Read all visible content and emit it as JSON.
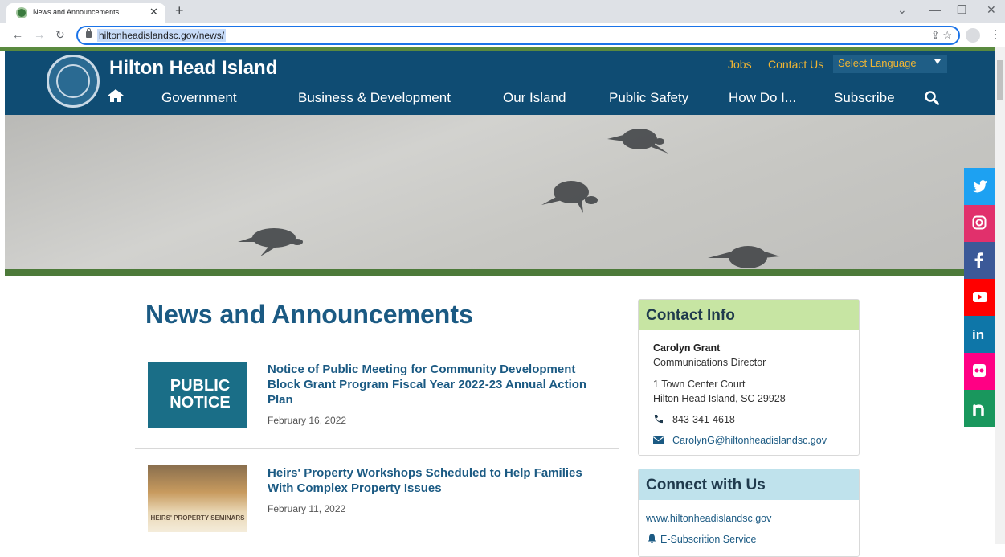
{
  "browser": {
    "tab_title": "News and Announcements",
    "url": "hiltonheadislandsc.gov/news/"
  },
  "site": {
    "title": "Hilton Head Island",
    "util_links": [
      "Jobs",
      "Contact Us"
    ],
    "language_select": "Select Language",
    "nav": [
      "Government",
      "Business & Development",
      "Our Island",
      "Public Safety",
      "How Do I...",
      "Subscribe"
    ]
  },
  "social": [
    {
      "icon": "twitter-icon",
      "color": "#1da1f2"
    },
    {
      "icon": "instagram-icon",
      "color": "#e1306c"
    },
    {
      "icon": "facebook-icon",
      "color": "#3b5998"
    },
    {
      "icon": "youtube-icon",
      "color": "#ff0000"
    },
    {
      "icon": "linkedin-icon",
      "color": "#0e76a8"
    },
    {
      "icon": "flickr-icon",
      "color": "#ff0084"
    },
    {
      "icon": "nextdoor-icon",
      "color": "#19975d"
    }
  ],
  "main": {
    "heading": "News and Announcements",
    "news": [
      {
        "thumb_text": "PUBLIC NOTICE",
        "title": "Notice of Public Meeting for Community Development Block Grant Program Fiscal Year 2022-23 Annual Action Plan",
        "date": "February 16, 2022"
      },
      {
        "thumb_text": "HEIRS' PROPERTY SEMINARS",
        "title": "Heirs' Property Workshops Scheduled to Help Families With Complex Property Issues",
        "date": "February 11, 2022"
      }
    ]
  },
  "sidebar": {
    "contact": {
      "heading": "Contact Info",
      "name": "Carolyn Grant",
      "role": "Communications Director",
      "address1": "1 Town Center Court",
      "address2": "Hilton Head Island, SC 29928",
      "phone": "843-341-4618",
      "email": "CarolynG@hiltonheadislandsc.gov",
      "head_color": "#c7e5a3"
    },
    "connect": {
      "heading": "Connect with Us",
      "website": "www.hiltonheadislandsc.gov",
      "subscription": "E-Subscrition Service",
      "head_color": "#bfe2ec"
    }
  }
}
